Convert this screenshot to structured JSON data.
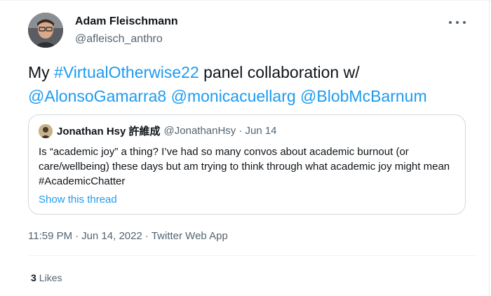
{
  "author": {
    "display_name": "Adam Fleischmann",
    "handle": "@afleisch_anthro"
  },
  "tweet": {
    "prefix": "My ",
    "hashtag": "#VirtualOtherwise22",
    "middle": " panel collaboration w/ ",
    "mention_1": "@AlonsoGamarra8",
    "mention_2": "@monicacuellarg",
    "mention_3": "@BlobMcBarnum"
  },
  "quoted": {
    "display_name": "Jonathan Hsy 許維成",
    "handle": "@JonathanHsy",
    "date": "· Jun 14",
    "text": "Is “academic joy” a thing? I’ve had so many convos about academic burnout (or care/wellbeing) these days but am trying to think through what academic joy might mean ",
    "hashtag": "#AcademicChatter",
    "show_thread": "Show this thread"
  },
  "meta": {
    "time": "11:59 PM",
    "date": "Jun 14, 2022",
    "source": "Twitter Web App",
    "separator": "·"
  },
  "stats": {
    "likes_count": "3",
    "likes_label": "Likes"
  },
  "colors": {
    "link": "#1d9bf0",
    "secondary_text": "#536471",
    "primary_text": "#0f1419",
    "border": "#cfd9de"
  },
  "icons": {
    "more": "more-horizontal-icon"
  }
}
